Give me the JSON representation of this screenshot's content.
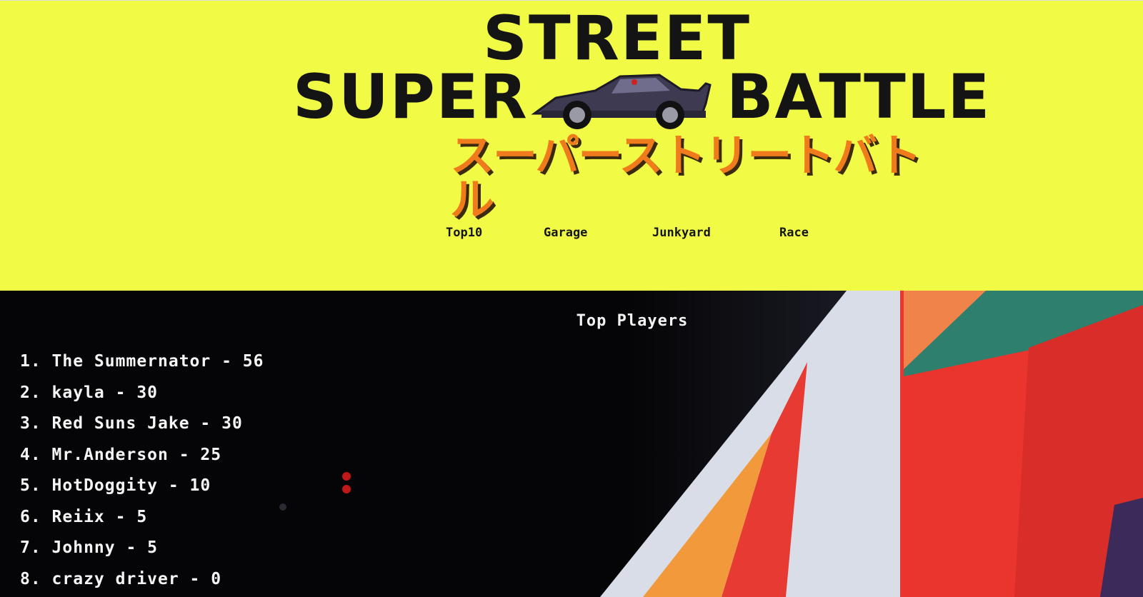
{
  "logo": {
    "line1": "STREET",
    "line2_left": "SUPER",
    "line2_right": "BATTLE",
    "japanese": "スーパーストリートバトル"
  },
  "nav": {
    "items": [
      {
        "label": "Top10"
      },
      {
        "label": "Garage"
      },
      {
        "label": "Junkyard"
      },
      {
        "label": "Race"
      }
    ]
  },
  "main": {
    "title": "Top Players",
    "players": [
      {
        "text": "1. The Summernator - 56"
      },
      {
        "text": "2. kayla - 30"
      },
      {
        "text": "3. Red Suns Jake - 30"
      },
      {
        "text": "4. Mr.Anderson - 25"
      },
      {
        "text": "5. HotDoggity - 10"
      },
      {
        "text": "6. Reiix - 5"
      },
      {
        "text": "7. Johnny - 5"
      },
      {
        "text": "8. crazy driver - 0"
      }
    ]
  },
  "colors": {
    "header_bg": "#f1fb45",
    "logo_text": "#141414",
    "logo_jp": "#f07b1c",
    "main_bg": "#050507"
  }
}
